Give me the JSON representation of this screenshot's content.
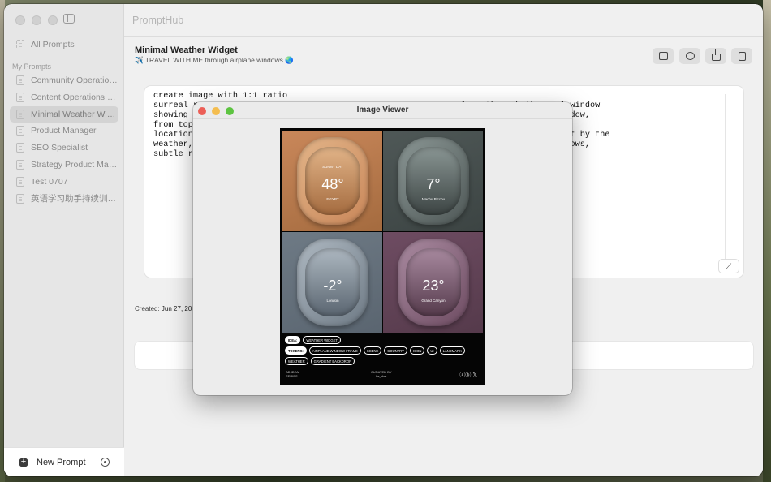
{
  "app": {
    "title": "PromptHub"
  },
  "sidebar": {
    "all_prompts": "All Prompts",
    "section": "My Prompts",
    "items": [
      {
        "label": "Community Operation..."
      },
      {
        "label": "Content Operations S..."
      },
      {
        "label": "Minimal Weather Wid..."
      },
      {
        "label": "Product Manager"
      },
      {
        "label": "SEO Specialist"
      },
      {
        "label": "Strategy Product Man..."
      },
      {
        "label": "Test 0707"
      },
      {
        "label": "英语学习助手持续训练版"
      }
    ],
    "active_index": 2,
    "new_prompt": "New Prompt"
  },
  "header": {
    "title": "Minimal Weather Widget",
    "subtitle": "✈️ TRAVEL WITH ME  through airplane windows 🌏",
    "actions": [
      "image-icon",
      "compass-icon",
      "share-icon",
      "copy-icon"
    ]
  },
  "editor": {
    "lines": [
      "create image with 1:1 ratio",
      "surreal r                                                   color, through the oval window",
      "showing                                                     ace on the center of window,",
      "from top                                                    t weight font, and small",
      "location                                                    s, the window will affect by the",
      "weather,                                                    ural lighting, soft shadows,",
      "subtle re"
    ],
    "action_icon": "magic-wand-icon"
  },
  "meta": {
    "created_label": "Created:",
    "created_value": "Jun 27, 20"
  },
  "viewer": {
    "title": "Image Viewer",
    "traffic_colors": [
      "#ec5f57",
      "#f4bd4f",
      "#5dc441"
    ],
    "poster": {
      "tiles": [
        {
          "temp": "48°",
          "top": "SUNNY DAY",
          "place": "EGYPT",
          "colors": [
            "#c9875a",
            "#e2b488",
            "#a46b3f"
          ]
        },
        {
          "temp": "7°",
          "top": "",
          "place": "Machu Picchu",
          "colors": [
            "#4f5857",
            "#8a9694",
            "#3c4443"
          ]
        },
        {
          "temp": "-2°",
          "top": "",
          "place": "London",
          "colors": [
            "#6e7a85",
            "#aeb8c1",
            "#5a6570"
          ]
        },
        {
          "temp": "23°",
          "top": "",
          "place": "Grand Canyon",
          "colors": [
            "#6e4c62",
            "#a98aa0",
            "#553a4b"
          ]
        }
      ],
      "tag_rows": [
        {
          "head": "IDEA:",
          "tags": [
            "WEATHER WIDGET"
          ]
        },
        {
          "head": "TOKENS:",
          "tags": [
            "AIRPLANE WINDOW FRAME",
            "SCENE",
            "COUNTRY",
            "ICON",
            "UI",
            "LANDMARK",
            "WEATHER",
            "GRADIENT BACKDROP"
          ]
        }
      ],
      "footer_left": "AD IDEA\nSERIES",
      "footer_center": "CURATED BY\nhe_doe",
      "footer_right": "ⓐⓑ 𝕏"
    }
  }
}
